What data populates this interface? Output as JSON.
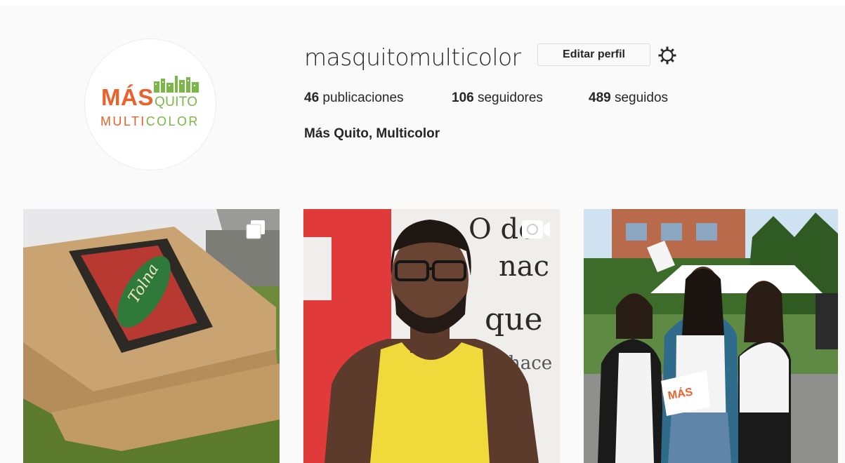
{
  "profile": {
    "username": "masquitomulticolor",
    "edit_label": "Editar perfil",
    "full_name": "Más Quito, Multicolor",
    "avatar": {
      "word1": "MÁS",
      "word2": "QUITO",
      "word3": "MULTICOLOR"
    }
  },
  "stats": {
    "posts_count": "46",
    "posts_label": "publicaciones",
    "followers_count": "106",
    "followers_label": "seguidores",
    "following_count": "489",
    "following_label": "seguidos"
  },
  "posts": [
    {
      "type": "carousel",
      "badge_icon": "carousel-icon",
      "box_text": "Tolna"
    },
    {
      "type": "video",
      "badge_icon": "video-camera-icon",
      "bg_text": [
        "O de",
        "nac",
        "que",
        "hace"
      ]
    },
    {
      "type": "image",
      "sign_text": "MÁS"
    }
  ],
  "colors": {
    "background": "#fafafa",
    "text": "#262626",
    "border": "#dbdbdb",
    "brand_orange": "#e8622a",
    "brand_green": "#7ab648"
  }
}
